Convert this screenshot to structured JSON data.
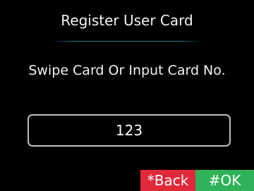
{
  "screen": {
    "title": "Register User Card",
    "prompt": "Swipe Card Or Input Card No.",
    "card_input": {
      "value": "123"
    }
  },
  "softkeys": {
    "back_label": "*Back",
    "ok_label": "#OK"
  },
  "colors": {
    "background": "#000000",
    "divider_accent": "#2d7f9d",
    "back_button": "#e02a3b",
    "ok_button": "#30b25a",
    "field_border": "#bdbdbd",
    "text": "#ffffff"
  }
}
